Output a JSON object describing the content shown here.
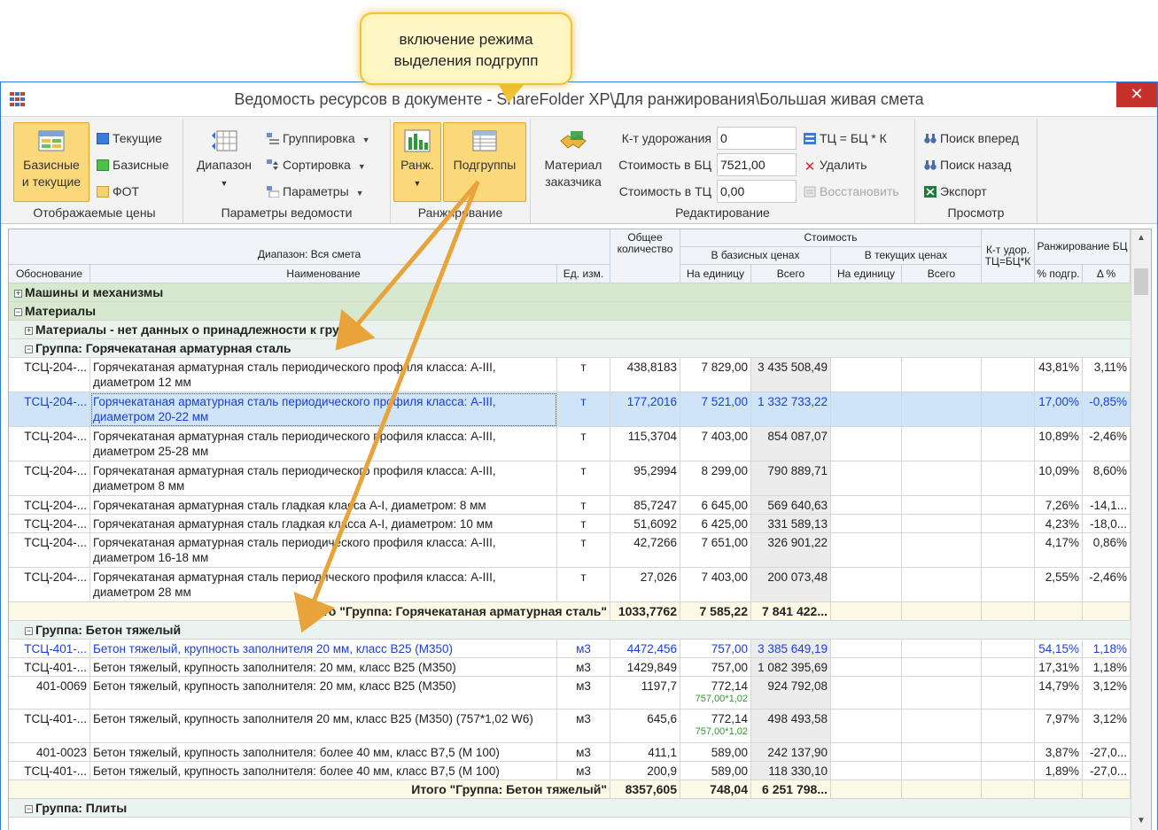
{
  "callout": {
    "line1": "включение режима",
    "line2": "выделения подгрупп"
  },
  "window": {
    "title": "Ведомость ресурсов в документе - ShareFolder XP\\Для ранжирования\\Большая живая смета",
    "close": "✕"
  },
  "ribbon": {
    "prices": {
      "big_label_1": "Базисные",
      "big_label_2": "и текущие",
      "current": "Текущие",
      "basic": "Базисные",
      "fot": "ФОТ",
      "group_label": "Отображаемые цены"
    },
    "params": {
      "range": "Диапазон",
      "grouping": "Группировка",
      "sorting": "Сортировка",
      "parameters": "Параметры",
      "group_label": "Параметры ведомости"
    },
    "ranking": {
      "rank": "Ранж.",
      "subgroups": "Подгруппы",
      "group_label": "Ранжирование"
    },
    "edit": {
      "customer_material_1": "Материал",
      "customer_material_2": "заказчика",
      "k_label": "К-т удорожания",
      "k_value": "0",
      "cost_bc_label": "Стоимость в БЦ",
      "cost_bc_value": "7521,00",
      "cost_tc_label": "Стоимость в ТЦ",
      "cost_tc_value": "0,00",
      "tc_eq": "ТЦ = БЦ * К",
      "delete": "Удалить",
      "restore": "Восстановить",
      "group_label": "Редактирование"
    },
    "view": {
      "find_next": "Поиск вперед",
      "find_prev": "Поиск назад",
      "export": "Экспорт",
      "group_label": "Просмотр"
    }
  },
  "grid": {
    "headers": {
      "range": "Диапазон: Вся смета",
      "basis": "Обоснование",
      "name": "Наименование",
      "unit": "Ед. изм.",
      "qty": "Общее количество",
      "cost": "Стоимость",
      "base_prices": "В базисных ценах",
      "cur_prices": "В текущих ценах",
      "per_unit_b": "На единицу",
      "total_b": "Всего",
      "per_unit_c": "На единицу",
      "total_c": "Всего",
      "kf": "К-т удор. ТЦ=БЦ*К",
      "ranking": "Ранжирование БЦ",
      "pct": "% подгр.",
      "delta": "Δ %"
    },
    "groups": {
      "machines": "Машины и механизмы",
      "materials": "Материалы",
      "no_group": "Материалы - нет данных о принадлежности к группе",
      "steel": "Группа: Горячекатаная арматурная сталь",
      "concrete": "Группа: Бетон тяжелый",
      "plates": "Группа: Плиты"
    },
    "steel_rows": [
      {
        "basis": "ТСЦ-204-...",
        "name": "Горячекатаная арматурная сталь периодического профиля класса: А-III, диаметром 12 мм",
        "unit": "т",
        "qty": "438,8183",
        "pu": "7 829,00",
        "total": "3 435 508,49",
        "pct": "43,81%",
        "delta": "3,11%"
      },
      {
        "basis": "ТСЦ-204-...",
        "name": "Горячекатаная арматурная сталь периодического профиля класса: А-III, диаметром 20-22 мм",
        "unit": "т",
        "qty": "177,2016",
        "pu": "7 521,00",
        "total": "1 332 733,22",
        "pct": "17,00%",
        "delta": "-0,85%"
      },
      {
        "basis": "ТСЦ-204-...",
        "name": "Горячекатаная арматурная сталь периодического профиля класса: А-III, диаметром 25-28 мм",
        "unit": "т",
        "qty": "115,3704",
        "pu": "7 403,00",
        "total": "854 087,07",
        "pct": "10,89%",
        "delta": "-2,46%"
      },
      {
        "basis": "ТСЦ-204-...",
        "name": "Горячекатаная арматурная сталь периодического профиля класса: А-III, диаметром 8 мм",
        "unit": "т",
        "qty": "95,2994",
        "pu": "8 299,00",
        "total": "790 889,71",
        "pct": "10,09%",
        "delta": "8,60%"
      },
      {
        "basis": "ТСЦ-204-...",
        "name": "Горячекатаная арматурная сталь гладкая класса А-I, диаметром: 8 мм",
        "unit": "т",
        "qty": "85,7247",
        "pu": "6 645,00",
        "total": "569 640,63",
        "pct": "7,26%",
        "delta": "-14,1..."
      },
      {
        "basis": "ТСЦ-204-...",
        "name": "Горячекатаная арматурная сталь гладкая класса А-I, диаметром: 10 мм",
        "unit": "т",
        "qty": "51,6092",
        "pu": "6 425,00",
        "total": "331 589,13",
        "pct": "4,23%",
        "delta": "-18,0..."
      },
      {
        "basis": "ТСЦ-204-...",
        "name": "Горячекатаная арматурная сталь периодического профиля класса: А-III, диаметром 16-18 мм",
        "unit": "т",
        "qty": "42,7266",
        "pu": "7 651,00",
        "total": "326 901,22",
        "pct": "4,17%",
        "delta": "0,86%"
      },
      {
        "basis": "ТСЦ-204-...",
        "name": "Горячекатаная арматурная сталь периодического профиля класса: А-III, диаметром 28 мм",
        "unit": "т",
        "qty": "27,026",
        "pu": "7 403,00",
        "total": "200 073,48",
        "pct": "2,55%",
        "delta": "-2,46%"
      }
    ],
    "steel_total": {
      "label": "Итого \"Группа: Горячекатаная арматурная сталь\"",
      "qty": "1033,7762",
      "pu": "7 585,22",
      "total": "7 841 422..."
    },
    "concrete_rows": [
      {
        "basis": "ТСЦ-401-...",
        "name": "Бетон тяжелый, крупность заполнителя 20 мм, класс В25 (М350)",
        "unit": "м3",
        "qty": "4472,456",
        "pu": "757,00",
        "sub": "",
        "total": "3 385 649,19",
        "pct": "54,15%",
        "delta": "1,18%"
      },
      {
        "basis": "ТСЦ-401-...",
        "name": "Бетон тяжелый, крупность заполнителя: 20 мм, класс В25 (М350)",
        "unit": "м3",
        "qty": "1429,849",
        "pu": "757,00",
        "sub": "",
        "total": "1 082 395,69",
        "pct": "17,31%",
        "delta": "1,18%"
      },
      {
        "basis": "401-0069",
        "name": "Бетон тяжелый, крупность заполнителя: 20 мм, класс В25 (М350)",
        "unit": "м3",
        "qty": "1197,7",
        "pu": "772,14",
        "sub": "757,00*1,02",
        "total": "924 792,08",
        "pct": "14,79%",
        "delta": "3,12%"
      },
      {
        "basis": "ТСЦ-401-...",
        "name": "Бетон тяжелый, крупность заполнителя 20 мм, класс В25 (М350) (757*1,02 W6)",
        "unit": "м3",
        "qty": "645,6",
        "pu": "772,14",
        "sub": "757,00*1,02",
        "total": "498 493,58",
        "pct": "7,97%",
        "delta": "3,12%"
      },
      {
        "basis": "401-0023",
        "name": "Бетон тяжелый, крупность заполнителя: более 40 мм, класс В7,5 (М 100)",
        "unit": "м3",
        "qty": "411,1",
        "pu": "589,00",
        "sub": "",
        "total": "242 137,90",
        "pct": "3,87%",
        "delta": "-27,0..."
      },
      {
        "basis": "ТСЦ-401-...",
        "name": "Бетон тяжелый, крупность заполнителя: более 40 мм, класс В7,5 (М 100)",
        "unit": "м3",
        "qty": "200,9",
        "pu": "589,00",
        "sub": "",
        "total": "118 330,10",
        "pct": "1,89%",
        "delta": "-27,0..."
      }
    ],
    "concrete_total": {
      "label": "Итого \"Группа: Бетон тяжелый\"",
      "qty": "8357,605",
      "pu": "748,04",
      "total": "6 251 798..."
    }
  },
  "colors": {
    "accent_orange": "#e8a33a",
    "selected_row": "#cfe4f7",
    "group_green": "#d6e9cf",
    "link_blue": "#1a3fd8"
  }
}
